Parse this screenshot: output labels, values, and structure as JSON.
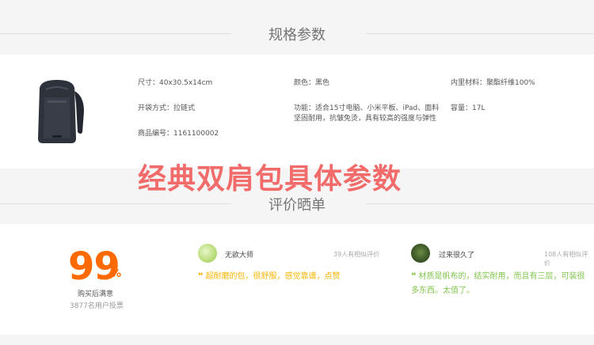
{
  "specs_section": {
    "title": "规格参数"
  },
  "specs": {
    "size": "尺寸：40x30.5x14cm",
    "color": "颜色：黑色",
    "lining": "内里材料：聚酯纤维100%",
    "opening": "开袋方式：拉链式",
    "function_line1": "功能：适合15寸电脑、小米平板、iPad、面料",
    "function_line2": "坚固耐用，抗皱免烫，具有较高的强度与弹性",
    "capacity": "容量：17L",
    "code": "商品编号：1161100002"
  },
  "overlay_text": "经典双肩包具体参数",
  "reviews_section": {
    "title": "评价晒单"
  },
  "satisfaction": {
    "score": "99",
    "unit": "%",
    "label": "购买后满意",
    "count": "3877名用户投票"
  },
  "reviews": [
    {
      "user": "无欲大师",
      "helpful": "39人有相似评价",
      "text": "超耐磨的包，很舒服，感觉靠谱，点赞",
      "color": "#f6b400"
    },
    {
      "user": "过来很久了",
      "helpful": "108人有相似评价",
      "text_line1": "材质是帆布的，结实耐用，而且有三层，可装很",
      "text_line2": "多东西。太值了。",
      "color": "#83c44e"
    }
  ],
  "icons": {
    "quote": "quote-icon"
  },
  "quote_glyph": "❝"
}
